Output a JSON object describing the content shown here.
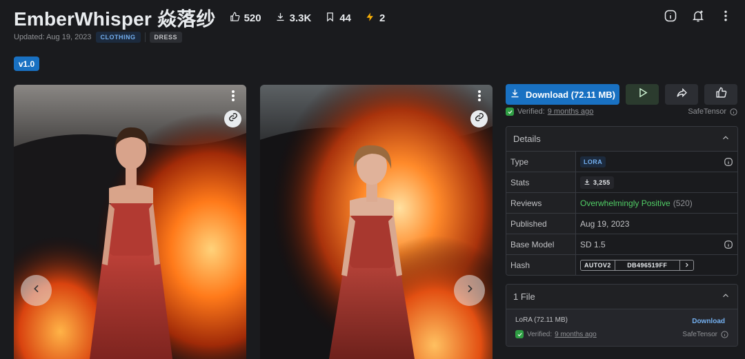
{
  "header": {
    "title": "EmberWhisper 焱落纱",
    "stats": {
      "likes": "520",
      "downloads": "3.3K",
      "bookmarks": "44",
      "buzz": "2"
    },
    "updated": "Updated: Aug 19, 2023",
    "tags": [
      "CLOTHING",
      "DRESS"
    ]
  },
  "version": "v1.0",
  "actions": {
    "download_label": "Download (72.11 MB)"
  },
  "verification": {
    "verified_label": "Verified:",
    "verified_ago": "9 months ago",
    "format": "SafeTensor"
  },
  "details": {
    "title": "Details",
    "rows": {
      "type": {
        "label": "Type",
        "value": "LORA"
      },
      "stats": {
        "label": "Stats",
        "value": "3,255"
      },
      "reviews": {
        "label": "Reviews",
        "value": "Overwhelmingly Positive",
        "count": "(520)"
      },
      "published": {
        "label": "Published",
        "value": "Aug 19, 2023"
      },
      "base_model": {
        "label": "Base Model",
        "value": "SD 1.5"
      },
      "hash": {
        "label": "Hash",
        "algo": "AUTOV2",
        "value": "DB496519FF"
      }
    }
  },
  "files": {
    "title": "1 File",
    "items": [
      {
        "name": "LoRA (72.11 MB)",
        "download_label": "Download",
        "verified_label": "Verified:",
        "verified_ago": "9 months ago",
        "format": "SafeTensor"
      }
    ]
  },
  "colors": {
    "background": "#1a1b1e",
    "accent": "#1971c2",
    "positive": "#51cf66"
  }
}
